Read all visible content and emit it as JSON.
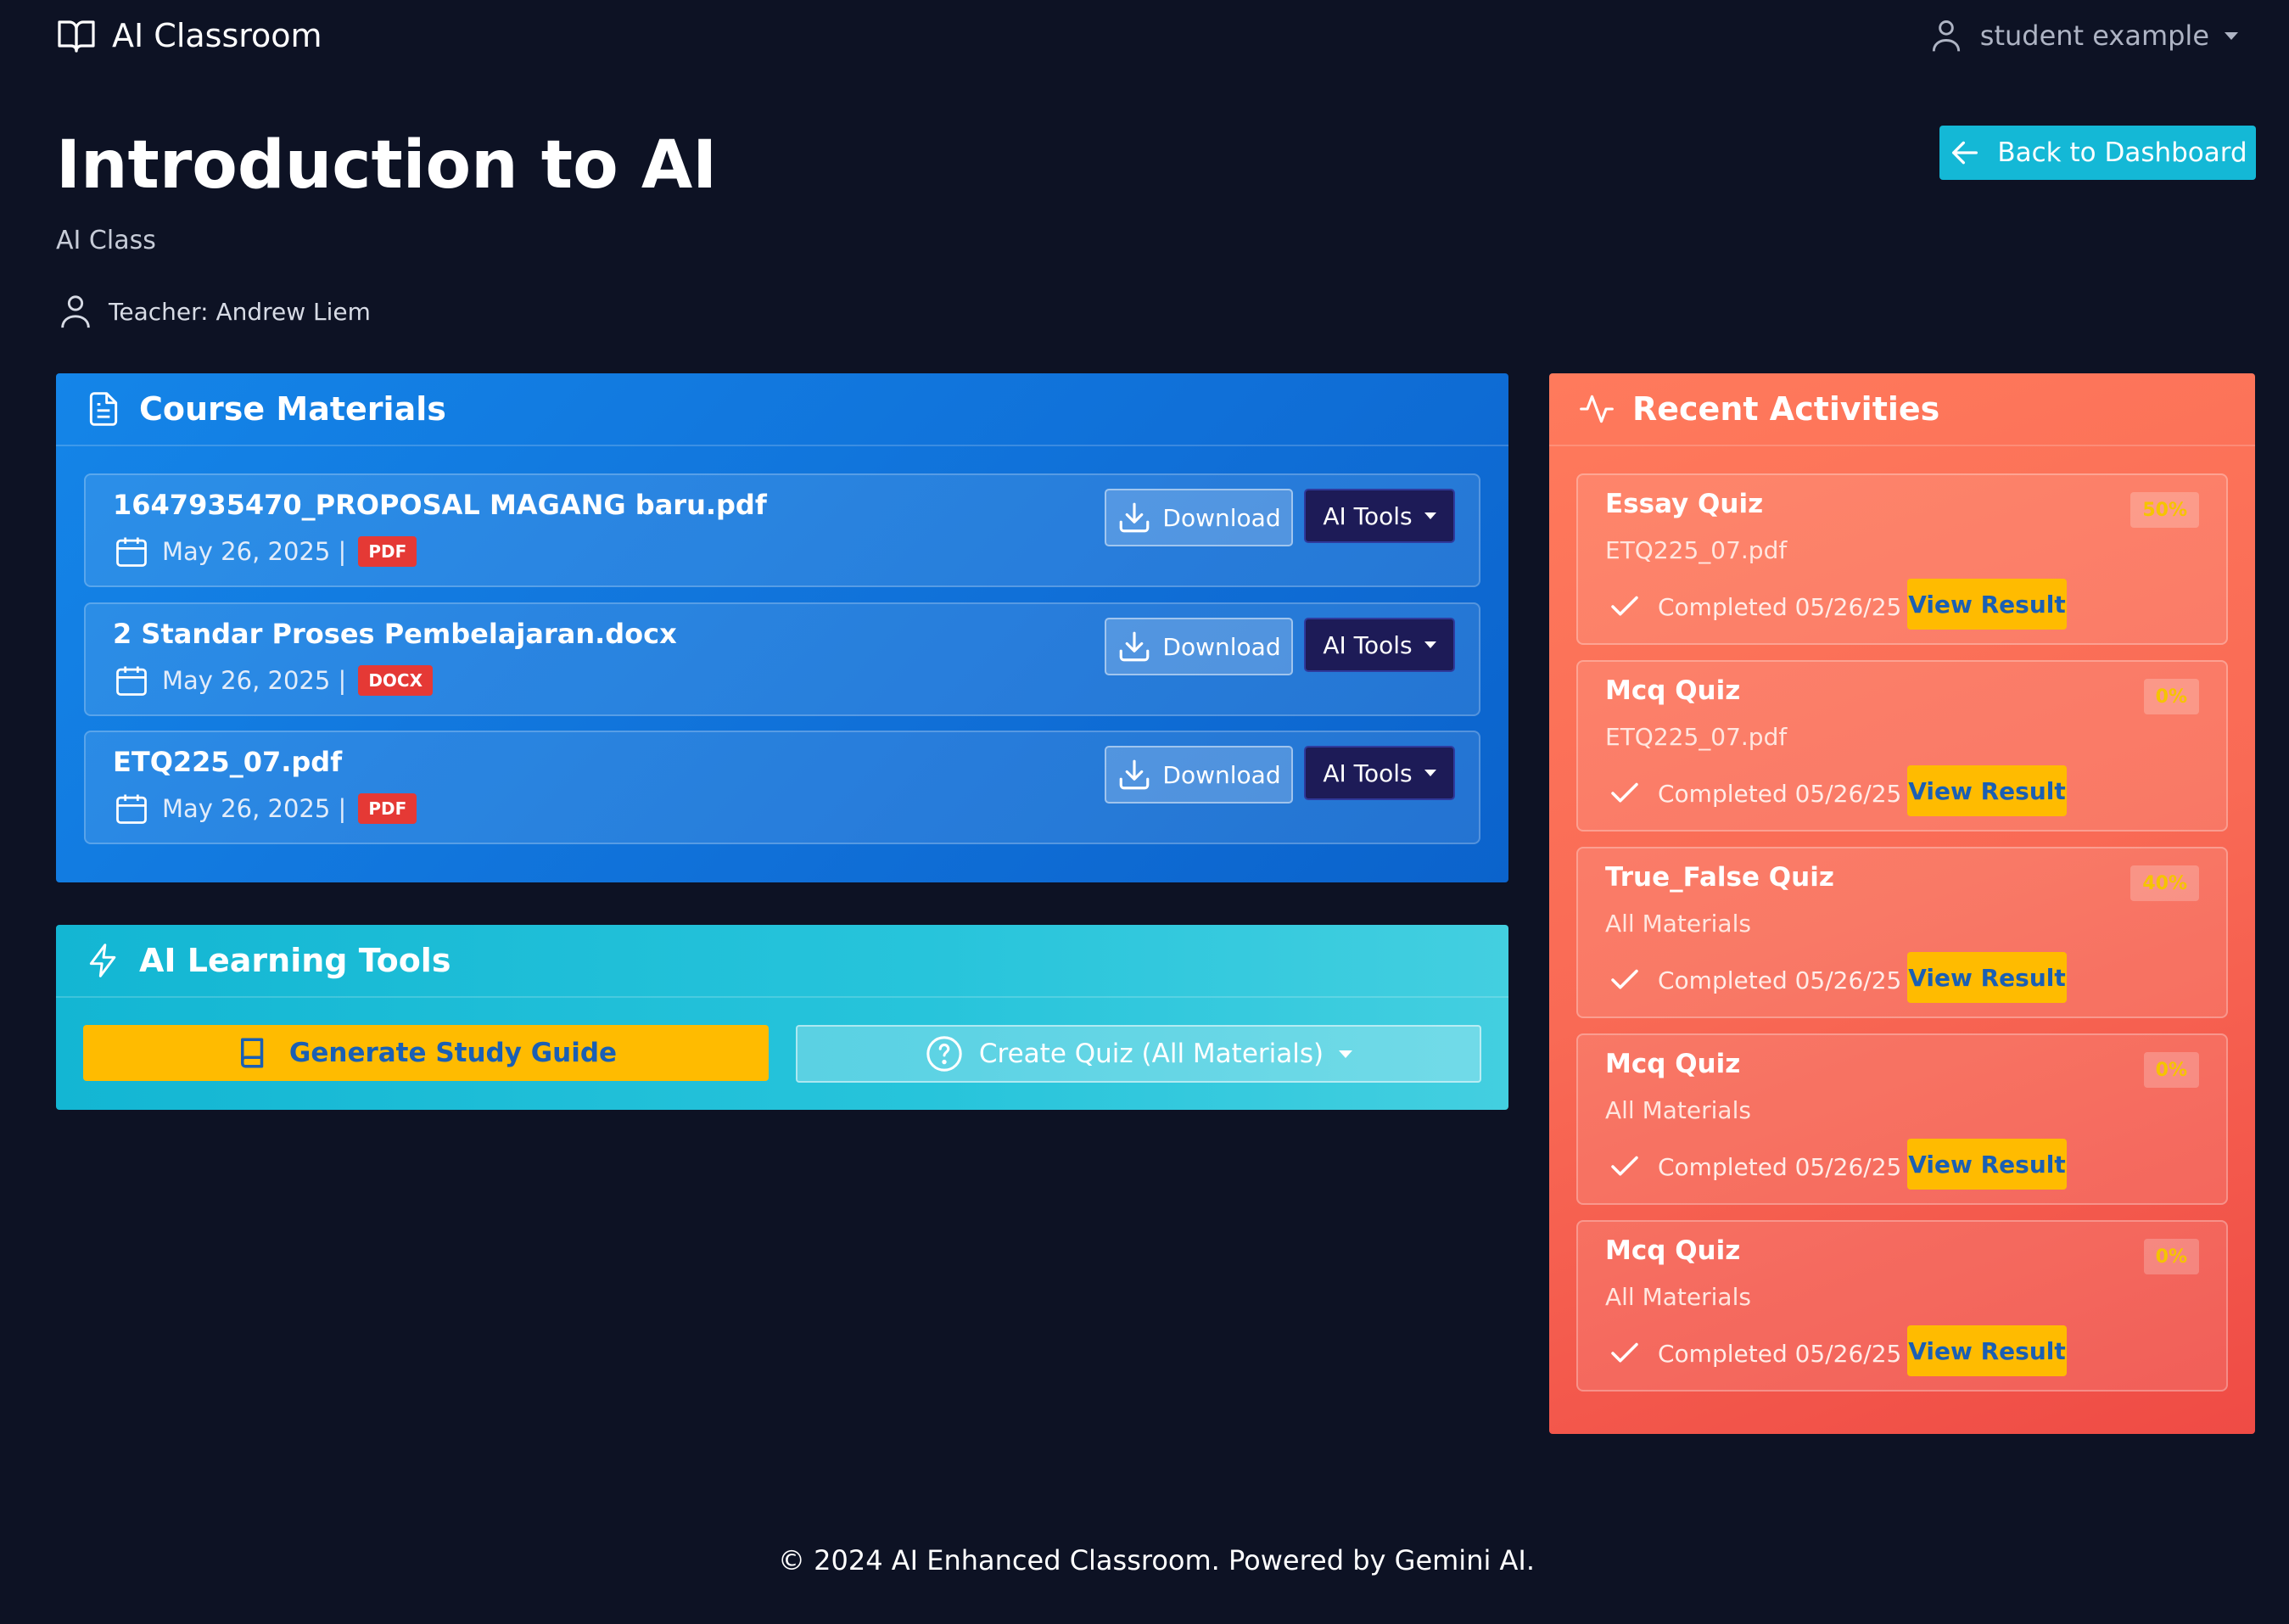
{
  "navbar": {
    "brand": "AI Classroom",
    "user": "student example",
    "icons": {
      "brand": "book-open-icon",
      "user": "user-icon",
      "caret": "chevron-down-icon"
    }
  },
  "header": {
    "title": "Introduction to AI",
    "subtitle": "AI Class",
    "teacher": "Teacher: Andrew Liem",
    "back_label": "Back to Dashboard"
  },
  "materials": {
    "title": "Course Materials",
    "download_label": "Download",
    "ai_tools_label": "AI Tools",
    "items": [
      {
        "name": "1647935470_PROPOSAL MAGANG baru.pdf",
        "date": "May 26, 2025 |",
        "type": "PDF"
      },
      {
        "name": "2 Standar Proses Pembelajaran.docx",
        "date": "May 26, 2025 |",
        "type": "DOCX"
      },
      {
        "name": "ETQ225_07.pdf",
        "date": "May 26, 2025 |",
        "type": "PDF"
      }
    ]
  },
  "tools": {
    "title": "AI Learning Tools",
    "study_guide_label": "Generate Study Guide",
    "create_quiz_label": "Create Quiz (All Materials)"
  },
  "activities": {
    "title": "Recent Activities",
    "view_label": "View Result",
    "items": [
      {
        "title": "Essay Quiz",
        "source": "ETQ225_07.pdf",
        "status": "Completed 05/26/25",
        "score": "50%"
      },
      {
        "title": "Mcq Quiz",
        "source": "ETQ225_07.pdf",
        "status": "Completed 05/26/25",
        "score": "0%"
      },
      {
        "title": "True_False Quiz",
        "source": "All Materials",
        "status": "Completed 05/26/25",
        "score": "40%"
      },
      {
        "title": "Mcq Quiz",
        "source": "All Materials",
        "status": "Completed 05/26/25",
        "score": "0%"
      },
      {
        "title": "Mcq Quiz",
        "source": "All Materials",
        "status": "Completed 05/26/25",
        "score": "0%"
      }
    ]
  },
  "footer": {
    "text": "© 2024 AI Enhanced Classroom. Powered by Gemini AI."
  },
  "colors": {
    "background": "#0d1224",
    "materials_card": "#1485e8",
    "tools_card": "#13b6d3",
    "activities_card": "#ff7a5c",
    "accent_yellow": "#ffbb00",
    "badge_red": "#e53935"
  }
}
